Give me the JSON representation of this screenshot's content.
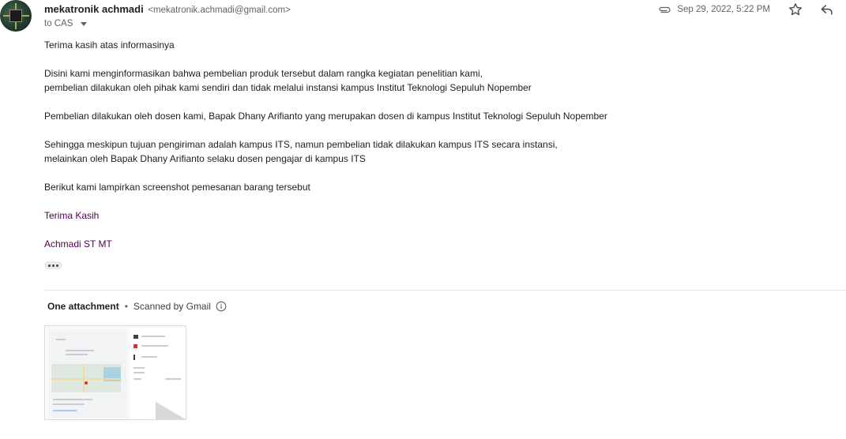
{
  "sender": {
    "name": "mekatronik achmadi",
    "email": "<mekatronik.achmadi@gmail.com>"
  },
  "recipient": {
    "to": "to CAS"
  },
  "meta": {
    "date": "Sep 29, 2022, 5:22 PM"
  },
  "icons": {
    "attachment": "paperclip-icon",
    "star": "star-icon",
    "reply": "reply-icon",
    "dropdown": "chevron-down-icon",
    "info": "info-icon",
    "more": "more-horizontal-icon"
  },
  "colors": {
    "signature": "#500050",
    "meta_text": "#5f6368"
  },
  "body": {
    "p1": "Terima kasih atas informasinya",
    "p2_line1": "Disini kami menginformasikan bahwa pembelian produk tersebut dalam rangka kegiatan penelitian kami,",
    "p2_line2": "pembelian dilakukan oleh pihak kami sendiri dan tidak melalui instansi kampus Institut Teknologi Sepuluh Nopember",
    "p3": "Pembelian dilakukan oleh dosen kami, Bapak Dhany Arifianto yang merupakan dosen di kampus Institut Teknologi Sepuluh Nopember",
    "p4_line1": "Sehingga meskipun tujuan pengiriman adalah kampus ITS, namun pembelian tidak dilakukan kampus ITS secara instansi,",
    "p4_line2": "melainkan oleh Bapak Dhany Arifianto selaku dosen pengajar di kampus ITS",
    "p5": "Berikut kami lampirkan screenshot pemesanan barang tersebut",
    "closing": "Terima Kasih",
    "signature": "Achmadi ST MT"
  },
  "attachments": {
    "count_label": "One attachment",
    "separator": "•",
    "scan_label": "Scanned by Gmail"
  }
}
